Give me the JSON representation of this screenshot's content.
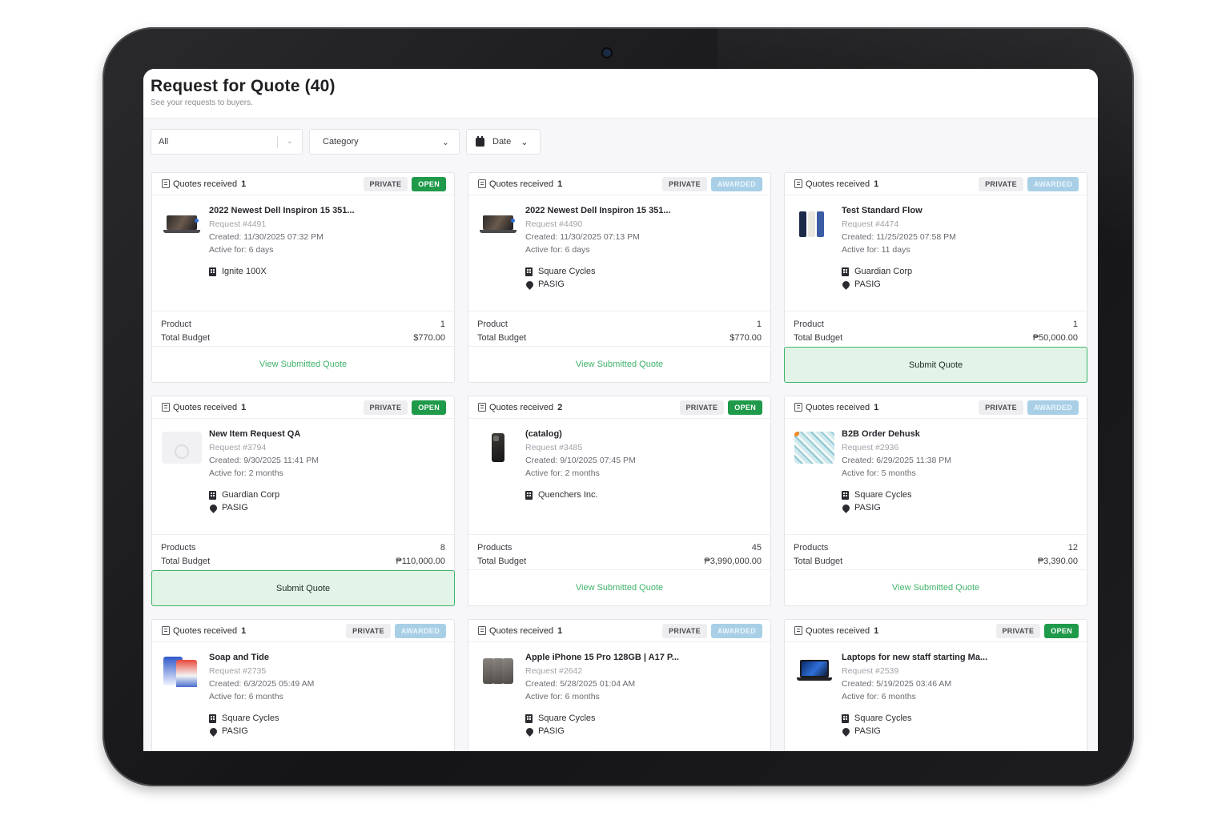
{
  "header": {
    "title": "Request for Quote (40)",
    "subtitle": "See your requests to buyers."
  },
  "filters": {
    "status": "All",
    "category": "Category",
    "date": "Date"
  },
  "colors": {
    "open_badge": "#1f9a4a",
    "awarded_badge": "#a8cfe6",
    "action_green": "#3fb36a",
    "submit_bg": "#e2f3e7"
  },
  "cards": [
    {
      "quotes_label": "Quotes received",
      "quotes_count": "1",
      "visibility": "PRIVATE",
      "status": "OPEN",
      "name": "2022 Newest Dell Inspiron 15 351...",
      "request": "Request #4491",
      "created": "Created: 11/30/2025 07:32 PM",
      "active": "Active for: 6 days",
      "org": "Ignite 100X",
      "location": "",
      "product_label": "Product",
      "product_count": "1",
      "budget_label": "Total Budget",
      "budget": "$770.00",
      "action": "View Submitted Quote",
      "action_type": "link",
      "thumb": "laptop"
    },
    {
      "quotes_label": "Quotes received",
      "quotes_count": "1",
      "visibility": "PRIVATE",
      "status": "AWARDED",
      "name": "2022 Newest Dell Inspiron 15 351...",
      "request": "Request #4490",
      "created": "Created: 11/30/2025 07:13 PM",
      "active": "Active for: 6 days",
      "org": "Square Cycles",
      "location": "PASIG",
      "product_label": "Product",
      "product_count": "1",
      "budget_label": "Total Budget",
      "budget": "$770.00",
      "action": "View Submitted Quote",
      "action_type": "link",
      "thumb": "laptop"
    },
    {
      "quotes_label": "Quotes received",
      "quotes_count": "1",
      "visibility": "PRIVATE",
      "status": "AWARDED",
      "name": "Test Standard Flow",
      "request": "Request #4474",
      "created": "Created: 11/25/2025 07:58 PM",
      "active": "Active for: 11 days",
      "org": "Guardian Corp",
      "location": "PASIG",
      "product_label": "Product",
      "product_count": "1",
      "budget_label": "Total Budget",
      "budget": "₱50,000.00",
      "action": "Submit Quote",
      "action_type": "submit",
      "thumb": "phones"
    },
    {
      "quotes_label": "Quotes received",
      "quotes_count": "1",
      "visibility": "PRIVATE",
      "status": "OPEN",
      "name": "New Item Request QA",
      "request": "Request #3794",
      "created": "Created: 9/30/2025 11:41 PM",
      "active": "Active for: 2 months",
      "org": "Guardian Corp",
      "location": "PASIG",
      "product_label": "Products",
      "product_count": "8",
      "budget_label": "Total Budget",
      "budget": "₱110,000.00",
      "action": "Submit Quote",
      "action_type": "submit",
      "thumb": "placeholder"
    },
    {
      "quotes_label": "Quotes received",
      "quotes_count": "2",
      "visibility": "PRIVATE",
      "status": "OPEN",
      "name": "(catalog)",
      "request": "Request #3485",
      "created": "Created: 9/10/2025 07:45 PM",
      "active": "Active for: 2 months",
      "org": "Quenchers Inc.",
      "location": "",
      "product_label": "Products",
      "product_count": "45",
      "budget_label": "Total Budget",
      "budget": "₱3,990,000.00",
      "action": "View Submitted Quote",
      "action_type": "link",
      "thumb": "iphone-dark"
    },
    {
      "quotes_label": "Quotes received",
      "quotes_count": "1",
      "visibility": "PRIVATE",
      "status": "AWARDED",
      "name": "B2B Order Dehusk",
      "request": "Request #2936",
      "created": "Created: 6/29/2025 11:38 PM",
      "active": "Active for: 5 months",
      "org": "Square Cycles",
      "location": "PASIG",
      "product_label": "Products",
      "product_count": "12",
      "budget_label": "Total Budget",
      "budget": "₱3,390.00",
      "action": "View Submitted Quote",
      "action_type": "link",
      "thumb": "fabric"
    },
    {
      "quotes_label": "Quotes received",
      "quotes_count": "1",
      "visibility": "PRIVATE",
      "status": "AWARDED",
      "name": "Soap and Tide",
      "request": "Request #2735",
      "created": "Created: 6/3/2025 05:49 AM",
      "active": "Active for: 6 months",
      "org": "Square Cycles",
      "location": "PASIG",
      "product_label": "",
      "product_count": "",
      "budget_label": "",
      "budget": "",
      "action": "",
      "action_type": "none",
      "thumb": "soap"
    },
    {
      "quotes_label": "Quotes received",
      "quotes_count": "1",
      "visibility": "PRIVATE",
      "status": "AWARDED",
      "name": "Apple iPhone 15 Pro 128GB | A17 P...",
      "request": "Request #2642",
      "created": "Created: 5/28/2025 01:04 AM",
      "active": "Active for: 6 months",
      "org": "Square Cycles",
      "location": "PASIG",
      "product_label": "",
      "product_count": "",
      "budget_label": "",
      "budget": "",
      "action": "",
      "action_type": "none",
      "thumb": "iphones"
    },
    {
      "quotes_label": "Quotes received",
      "quotes_count": "1",
      "visibility": "PRIVATE",
      "status": "OPEN",
      "name": "Laptops for new staff starting Ma...",
      "request": "Request #2539",
      "created": "Created: 5/19/2025 03:46 AM",
      "active": "Active for: 6 months",
      "org": "Square Cycles",
      "location": "PASIG",
      "product_label": "",
      "product_count": "",
      "budget_label": "",
      "budget": "",
      "action": "",
      "action_type": "none",
      "thumb": "blue-laptop"
    }
  ]
}
